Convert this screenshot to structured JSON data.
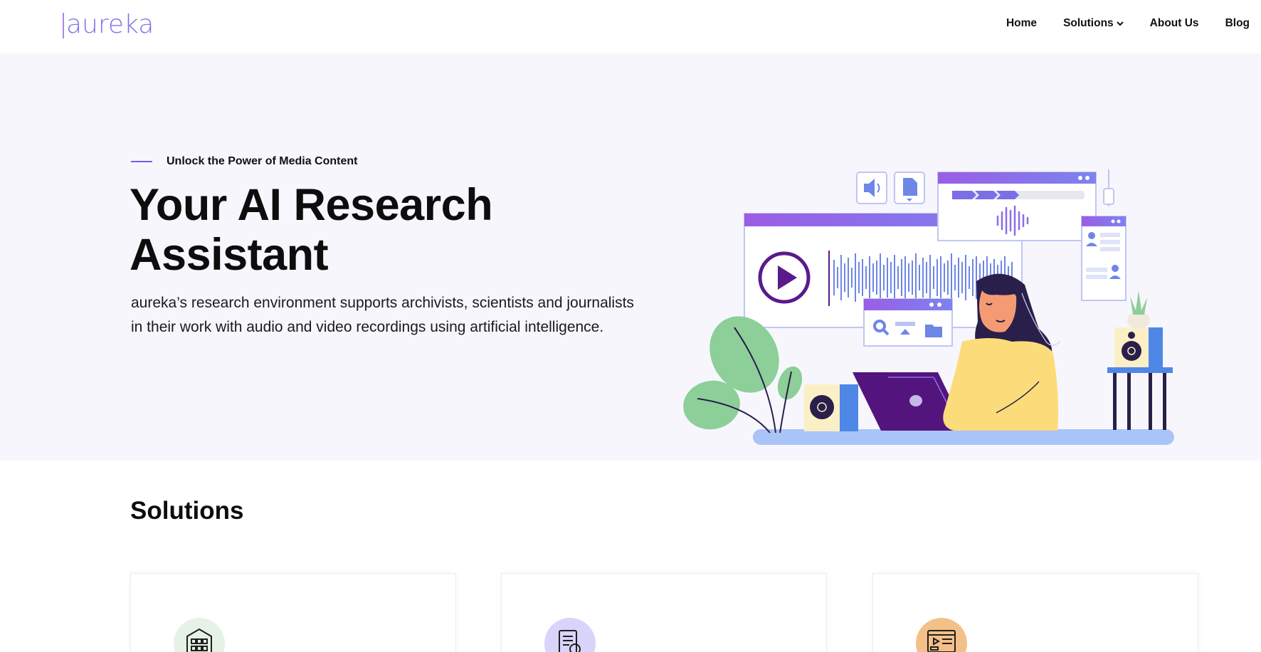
{
  "brand": {
    "name": "aureka",
    "accent": "#7f75e8"
  },
  "nav": {
    "items": [
      {
        "label": "Home"
      },
      {
        "label": "Solutions",
        "has_dropdown": true
      },
      {
        "label": "About Us"
      },
      {
        "label": "Blog"
      }
    ]
  },
  "hero": {
    "eyebrow": "Unlock the Power of Media Content",
    "title": "Your AI Research Assistant",
    "description": "aureka’s research environment supports archivists, scientists and journalists in their work with audio and video recordings using artificial intelligence.",
    "background": "#f7f6fd"
  },
  "solutions": {
    "title": "Solutions",
    "cards": [
      {
        "icon": "building-icon",
        "badge_color": "#e6f2e6"
      },
      {
        "icon": "document-search-icon",
        "badge_color": "#d9d4fa"
      },
      {
        "icon": "video-editor-icon",
        "badge_color": "#f4c089"
      }
    ]
  }
}
